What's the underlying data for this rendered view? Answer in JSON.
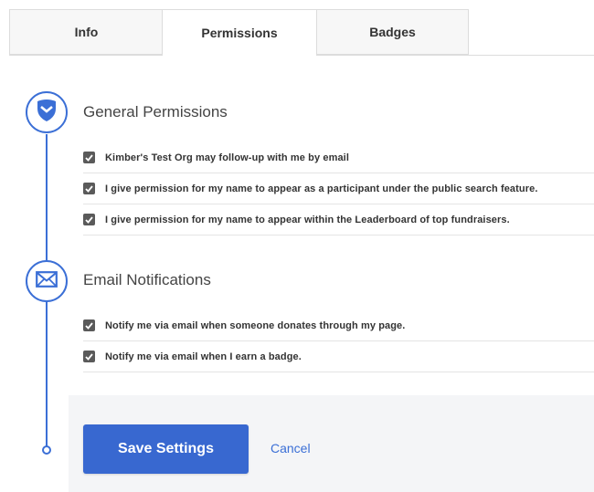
{
  "tabs": [
    {
      "label": "Info"
    },
    {
      "label": "Permissions",
      "active": true
    },
    {
      "label": "Badges"
    }
  ],
  "general": {
    "title": "General Permissions",
    "icon": "shield-icon",
    "items": [
      {
        "label": "Kimber's Test Org may follow-up with me by email",
        "checked": true
      },
      {
        "label": "I give permission for my name to appear as a participant under the public search feature.",
        "checked": true
      },
      {
        "label": "I give permission for my name to appear within the Leaderboard of top fundraisers.",
        "checked": true
      }
    ]
  },
  "email": {
    "title": "Email Notifications",
    "icon": "envelope-icon",
    "items": [
      {
        "label": "Notify me via email when someone donates through my page.",
        "checked": true
      },
      {
        "label": "Notify me via email when I earn a badge.",
        "checked": true
      }
    ]
  },
  "actions": {
    "save_label": "Save Settings",
    "cancel_label": "Cancel"
  },
  "colors": {
    "accent": "#3b6fd6",
    "button": "#3868d0",
    "checkbox": "#5a5a5a",
    "footer_bg": "#f4f5f7"
  }
}
